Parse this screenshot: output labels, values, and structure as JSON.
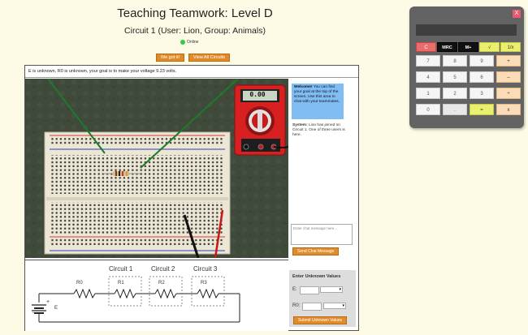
{
  "header": {
    "title": "Teaching Teamwork: Level D",
    "subtitle": "Circuit 1 (User: Lion, Group: Animals)",
    "status": "Online",
    "buttons": [
      "We got it!",
      "View All Circuits"
    ]
  },
  "goal_text": "E is unknown, R0 is unknown, your goal is to make your voltage 9.23 volts.",
  "multimeter": {
    "reading": "0.00"
  },
  "chat": {
    "welcome_title": "Welcome!",
    "welcome_body": "You can find your goal at the top of the screen. Use this area to chat with your teammates.",
    "system_title": "System:",
    "system_body": "Lion has joined on Circuit 1. One of three users is here.",
    "input_placeholder": "Enter chat message here...",
    "send_label": "Send Chat Message"
  },
  "circuit": {
    "labels": [
      "Circuit 1",
      "Circuit 2",
      "Circuit 3"
    ],
    "resistors": [
      "R0",
      "R1",
      "R2",
      "R3"
    ],
    "source": "E",
    "plus": "+",
    "minus": "-"
  },
  "unknowns": {
    "title": "Enter Unknown Values",
    "fields": [
      {
        "label": "E:",
        "value": ""
      },
      {
        "label": "R0:",
        "value": ""
      }
    ],
    "submit_label": "Submit Unknown Values"
  },
  "calculator": {
    "close": "X",
    "rows": [
      [
        "C",
        "MRC",
        "M+",
        "√",
        "1/x"
      ],
      [
        "7",
        "8",
        "9",
        "+"
      ],
      [
        "4",
        "5",
        "6",
        "–"
      ],
      [
        "1",
        "2",
        "3",
        "÷"
      ],
      [
        "0",
        ".",
        "=",
        "x"
      ]
    ]
  },
  "colors": {
    "orange_button": "#e08c2c",
    "welcome_bg": "#7fbdf2",
    "board_bg": "#3f4a3b",
    "page_bg": "#fdfbe6"
  }
}
